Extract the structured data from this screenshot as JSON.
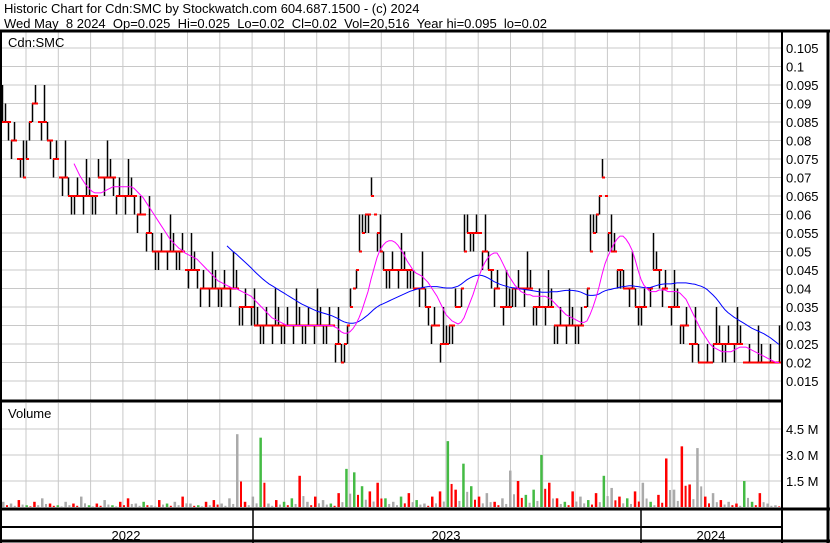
{
  "header": {
    "title": "Historic Chart for Cdn:SMC by Stockwatch.com 604.687.1500 - (c) 2024",
    "quote": "Wed May  8 2024  Op=0.025  Hi=0.025  Lo=0.02  Cl=0.02  Vol=20,516  Year hi=0.095  lo=0.02"
  },
  "chart_data": {
    "type": "bar",
    "price_panel": {
      "label": "Cdn:SMC",
      "ylim": [
        0.0125,
        0.1075
      ],
      "yticks": [
        "0.105",
        "0.1",
        "0.095",
        "0.09",
        "0.085",
        "0.08",
        "0.075",
        "0.07",
        "0.065",
        "0.06",
        "0.055",
        "0.05",
        "0.045",
        "0.04",
        "0.035",
        "0.03",
        "0.025",
        "0.02",
        "0.015"
      ],
      "close_keyframes": [
        [
          0,
          0.085
        ],
        [
          4,
          0.08
        ],
        [
          7,
          0.07
        ],
        [
          10,
          0.09
        ],
        [
          13,
          0.085
        ],
        [
          18,
          0.075
        ],
        [
          22,
          0.065
        ],
        [
          30,
          0.065
        ],
        [
          33,
          0.07
        ],
        [
          42,
          0.065
        ],
        [
          46,
          0.06
        ],
        [
          51,
          0.05
        ],
        [
          58,
          0.05
        ],
        [
          63,
          0.045
        ],
        [
          69,
          0.04
        ],
        [
          76,
          0.04
        ],
        [
          80,
          0.035
        ],
        [
          86,
          0.03
        ],
        [
          100,
          0.03
        ],
        [
          110,
          0.03
        ],
        [
          113,
          0.02
        ],
        [
          117,
          0.04
        ],
        [
          120,
          0.055
        ],
        [
          123,
          0.065
        ],
        [
          127,
          0.045
        ],
        [
          133,
          0.045
        ],
        [
          140,
          0.04
        ],
        [
          143,
          0.03
        ],
        [
          147,
          0.025
        ],
        [
          152,
          0.035
        ],
        [
          155,
          0.055
        ],
        [
          158,
          0.055
        ],
        [
          162,
          0.045
        ],
        [
          167,
          0.035
        ],
        [
          173,
          0.04
        ],
        [
          180,
          0.035
        ],
        [
          187,
          0.03
        ],
        [
          193,
          0.03
        ],
        [
          197,
          0.055
        ],
        [
          200,
          0.07
        ],
        [
          203,
          0.05
        ],
        [
          207,
          0.04
        ],
        [
          213,
          0.035
        ],
        [
          218,
          0.045
        ],
        [
          223,
          0.035
        ],
        [
          227,
          0.03
        ],
        [
          230,
          0.025
        ],
        [
          233,
          0.02
        ],
        [
          240,
          0.025
        ],
        [
          253,
          0.02
        ],
        [
          259,
          0.02
        ]
      ],
      "ma_short_color": "#ff00ff",
      "ma_long_color": "#0000ff",
      "bar_color": "#000000",
      "close_tick_color": "#ff0000"
    },
    "volume_panel": {
      "label": "Volume",
      "yticks": [
        "4.5 M",
        "3.0 M",
        "1.5 M"
      ],
      "ylim": [
        0,
        5.5
      ],
      "values_millions": [
        0.3,
        0.2,
        0.4,
        0.1,
        0.3,
        0.5,
        0.2,
        0.1,
        0.3,
        0.2,
        0.6,
        0.1,
        0.2,
        0.4,
        0.1,
        0.3,
        0.5,
        0.2,
        0.3,
        0.1,
        0.4,
        0.2,
        0.3,
        0.6,
        0.2,
        0.1,
        0.3,
        0.4,
        0.2,
        0.5,
        4.2,
        0.3,
        0.6,
        4.0,
        0.2,
        0.4,
        0.3,
        0.5,
        1.8,
        0.3,
        0.6,
        0.4,
        0.2,
        0.8,
        2.2,
        2.0,
        1.2,
        0.9,
        1.4,
        0.5,
        0.3,
        0.6,
        0.8,
        0.4,
        0.2,
        0.6,
        0.9,
        3.8,
        1.0,
        2.5,
        1.2,
        0.6,
        0.8,
        0.3,
        0.5,
        2.1,
        1.5,
        0.7,
        1.0,
        3.0,
        1.4,
        0.5,
        0.3,
        0.9,
        0.6,
        0.4,
        0.8,
        1.8,
        1.1,
        0.6,
        0.5,
        0.9,
        1.4,
        0.3,
        0.7,
        2.8,
        1.0,
        3.5,
        1.3,
        3.4,
        0.6,
        0.8,
        0.4,
        0.3,
        0.2,
        1.5,
        0.3,
        0.8,
        0.2,
        0.1
      ],
      "colors": "kkrgrkrgkrkgrkgrrkgkrgkrkgrrkkkrkgkrggrkrkgrgggrrgkgrgkrrgrggrkrkkrgggrrgrkgrgkrgrkgrrkrrkrkrkrggrk",
      "color_map": {
        "r": "#ff0000",
        "g": "#44bb44",
        "k": "#aaaaaa"
      }
    },
    "x_axis": {
      "labels": [
        "2022",
        "2023",
        "2024"
      ]
    }
  }
}
